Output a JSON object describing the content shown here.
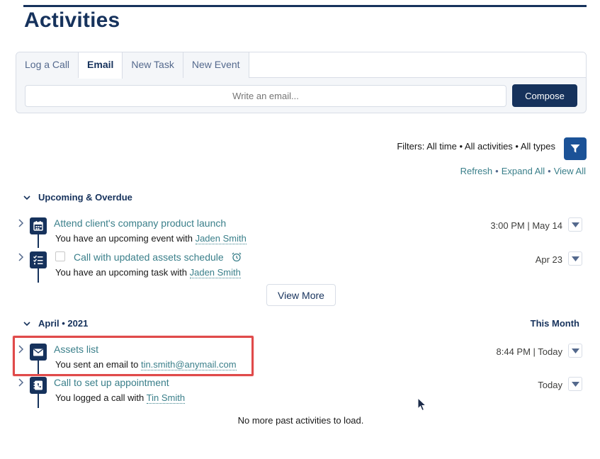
{
  "page": {
    "title": "Activities"
  },
  "composer": {
    "tabs": [
      {
        "label": "Log a Call",
        "active": false
      },
      {
        "label": "Email",
        "active": true
      },
      {
        "label": "New Task",
        "active": false
      },
      {
        "label": "New Event",
        "active": false
      }
    ],
    "input_placeholder": "Write an email...",
    "compose_label": "Compose"
  },
  "filters": {
    "text": "Filters: All time • All activities • All types",
    "icon": "filter-icon",
    "links": {
      "refresh": "Refresh",
      "expand_all": "Expand All",
      "view_all": "View All",
      "separator": "•"
    }
  },
  "sections": [
    {
      "heading": "Upcoming & Overdue",
      "items": [
        {
          "icon": "calendar-icon",
          "title": "Attend client's company product launch",
          "subtitle_prefix": "You have an upcoming event with",
          "who": "Jaden Smith",
          "date": "3:00 PM | May 14"
        },
        {
          "icon": "task-icon",
          "title": "Call with updated assets schedule",
          "reminder_icon": "alarm-clock-icon",
          "subtitle_prefix": "You have an upcoming task with",
          "who": "Jaden Smith",
          "date": "Apr 23"
        }
      ],
      "view_more": "View More"
    },
    {
      "heading": "April • 2021",
      "right_label": "This Month",
      "items": [
        {
          "icon": "email-icon",
          "title": "Assets list",
          "subtitle_prefix": "You sent an email to",
          "who": "tin.smith@anymail.com",
          "date": "8:44 PM | Today",
          "highlighted": true
        },
        {
          "icon": "call-log-icon",
          "title": "Call to set up appointment",
          "subtitle_prefix": "You logged a call with",
          "who": "Tin Smith",
          "date": "Today"
        }
      ]
    }
  ],
  "footer": {
    "no_more": "No more past activities to load."
  },
  "colors": {
    "navy": "#16325c",
    "link_teal": "#3a7f8a",
    "filter_blue": "#1b5297",
    "highlight_red": "#e04a4a",
    "border": "#d8dde6"
  }
}
